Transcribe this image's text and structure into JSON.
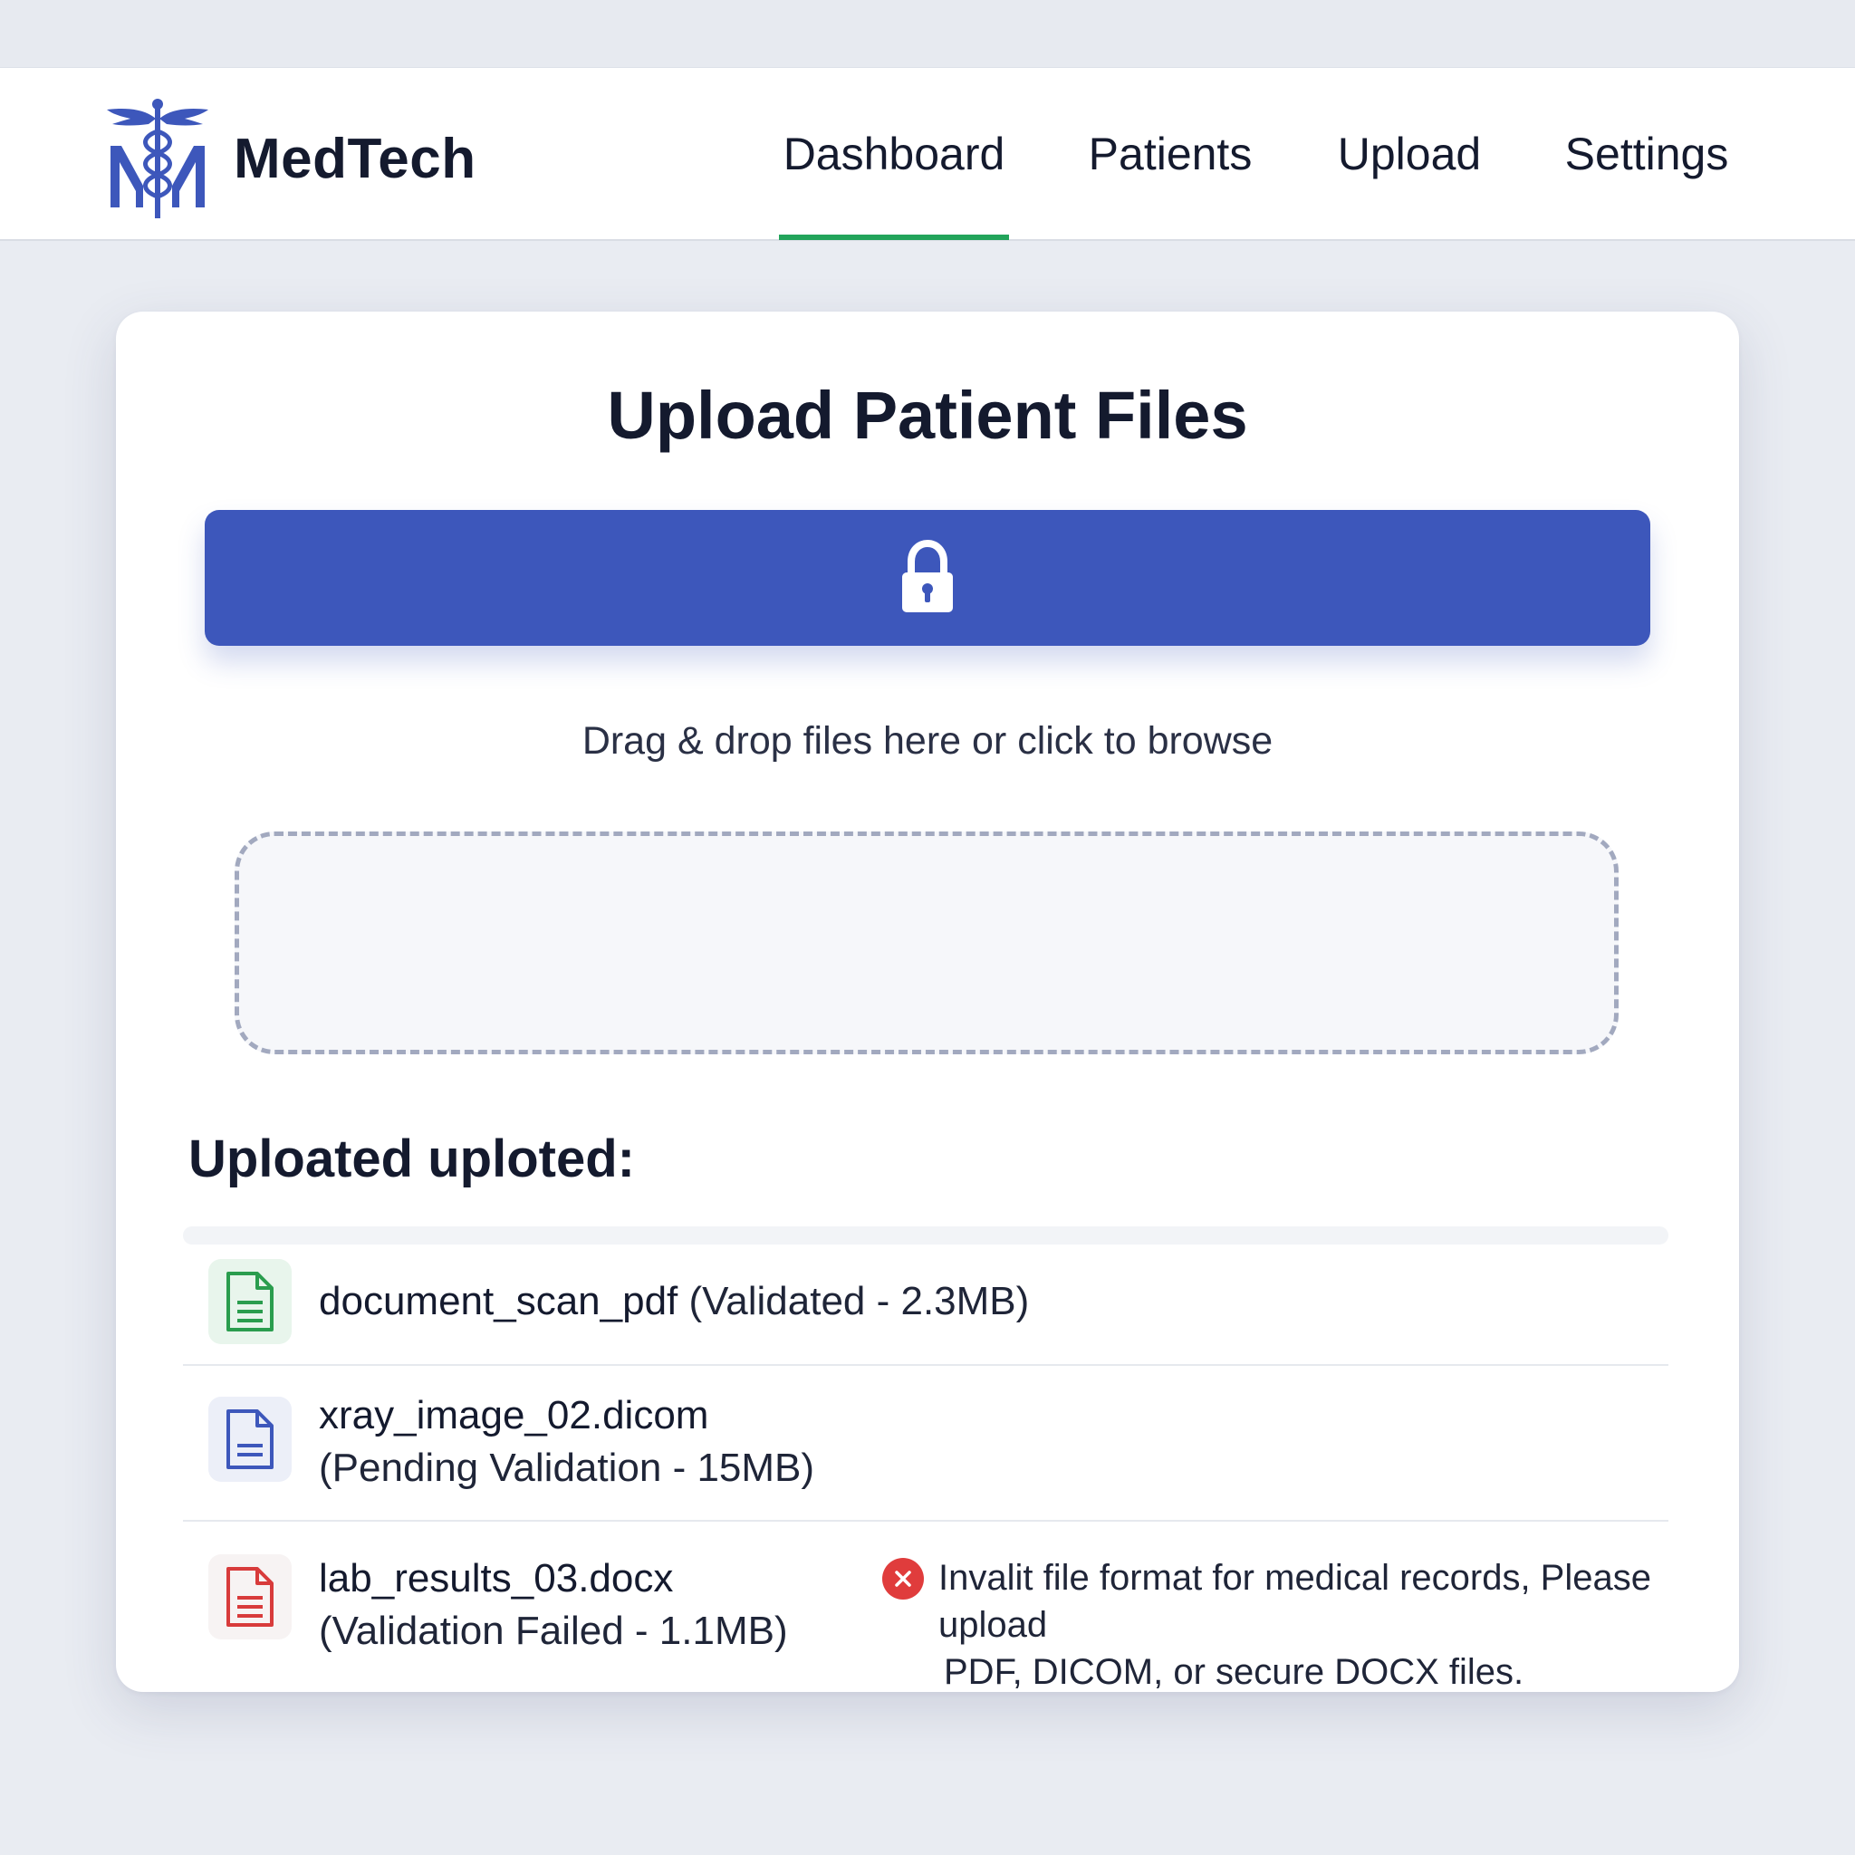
{
  "app": {
    "brand_name": "MedTech",
    "logo_icon": "caduceus-m-logo-icon"
  },
  "nav": {
    "items": [
      {
        "label": "Dashboard",
        "active": true
      },
      {
        "label": "Patients",
        "active": false
      },
      {
        "label": "Upload",
        "active": false
      },
      {
        "label": "Settings",
        "active": false
      }
    ]
  },
  "upload": {
    "title": "Upload Patient Files",
    "button_icon": "lock-icon",
    "drop_hint": "Drag & drop files here or click to browse"
  },
  "files": {
    "heading": "Uploated uploted:",
    "items": [
      {
        "icon": "document-icon",
        "name": "document_scan_pdf",
        "status": "(Validated - 2.3MB)",
        "color": "#2a9d4e",
        "bg": "#e8f5ec"
      },
      {
        "icon": "document-icon",
        "name": "xray_image_02.dicom",
        "status": "(Pending Validation - 15MB)",
        "color": "#3d57bb",
        "bg": "#eceff8"
      },
      {
        "icon": "document-icon",
        "name": "lab_results_03.docx",
        "status": "(Validation Failed - 1.1MB)",
        "color": "#d83b3b",
        "bg": "#f7f3f3",
        "error_icon": "error-x-icon",
        "error_line1": "Invalit file format for medical records, Please upload",
        "error_line2": "PDF, DICOM, or secure DOCX files."
      }
    ]
  },
  "colors": {
    "accent": "#3d57bb",
    "active_tab": "#22a45a",
    "error": "#e03c3c"
  }
}
